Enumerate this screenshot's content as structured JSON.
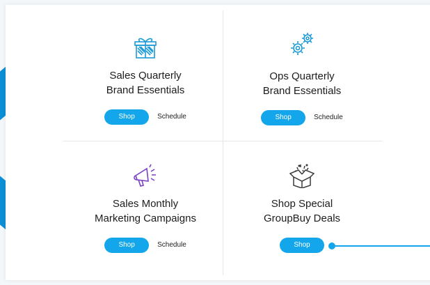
{
  "cards": [
    {
      "title_line1": "Sales Quarterly",
      "title_line2": "Brand Essentials",
      "icon": "gift-box-icon",
      "shop_label": "Shop",
      "schedule_label": "Schedule"
    },
    {
      "title_line1": "Ops Quarterly",
      "title_line2": "Brand Essentials",
      "icon": "gears-icon",
      "shop_label": "Shop",
      "schedule_label": "Schedule"
    },
    {
      "title_line1": "Sales Monthly",
      "title_line2": "Marketing Campaigns",
      "icon": "megaphone-icon",
      "shop_label": "Shop",
      "schedule_label": "Schedule"
    },
    {
      "title_line1": "Shop Special",
      "title_line2": "GroupBuy Deals",
      "icon": "open-box-icon",
      "shop_label": "Shop"
    }
  ],
  "colors": {
    "accent": "#13a6eb",
    "icon_blue": "#1a9ad6",
    "icon_purple": "#7b3fc4",
    "icon_dark": "#3a3a3a",
    "stripe": "#0c8fd6"
  }
}
